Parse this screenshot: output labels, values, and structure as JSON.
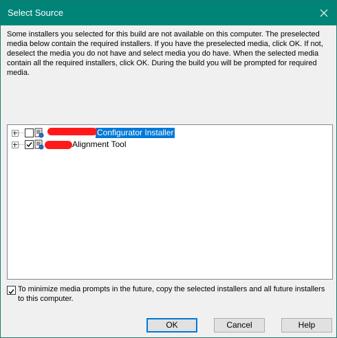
{
  "window": {
    "title": "Select Source"
  },
  "description": "Some installers you selected for this build are not available on this computer. The preselected media below contain the required installers. If you have the preselected media, click OK. If not, deselect the media you do not have and select media you do have. When the selected media contain all the required installers, click OK. During the build you will be prompted for required media.",
  "tree": {
    "items": [
      {
        "label": "Configurator Installer",
        "checked": false,
        "selected": true,
        "icon": "media-icon"
      },
      {
        "label": "Alignment Tool",
        "checked": true,
        "selected": false,
        "icon": "media-icon"
      }
    ]
  },
  "copy_option": {
    "label": "To minimize media prompts in the future, copy the selected installers and all future installers to this computer.",
    "checked": true
  },
  "buttons": {
    "ok": "OK",
    "cancel": "Cancel",
    "help": "Help"
  },
  "colors": {
    "titlebar": "#008478",
    "selection": "#0078d7",
    "redaction": "#ff1a1a"
  }
}
